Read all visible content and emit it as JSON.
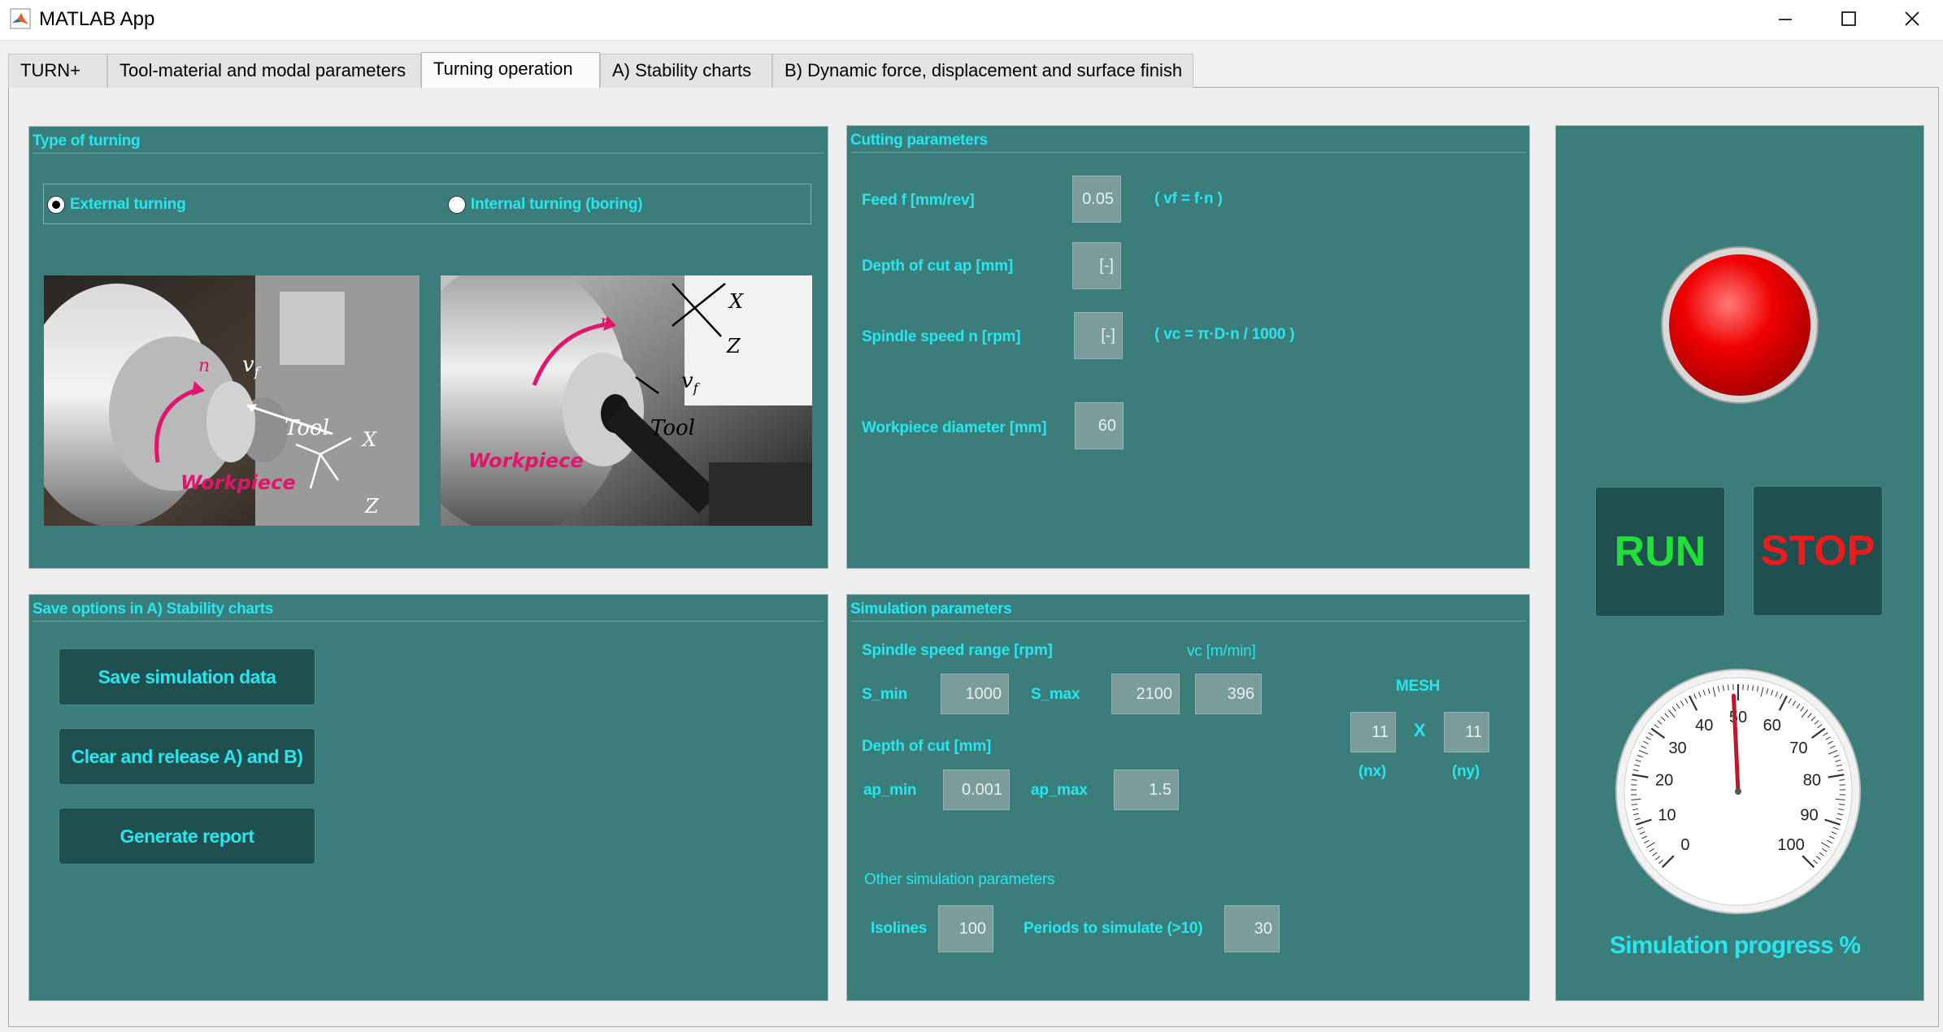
{
  "window": {
    "title": "MATLAB App"
  },
  "tabs": [
    "TURN+",
    "Tool-material and modal parameters",
    "Turning operation",
    "A) Stability charts",
    "B) Dynamic force, displacement and surface finish"
  ],
  "type_of_turning": {
    "title": "Type of turning",
    "option_external": "External turning",
    "option_internal": "Internal turning (boring)",
    "selected": "External turning",
    "image1": {
      "n": "n",
      "vf": "v",
      "vf_sub": "f",
      "tool": "Tool",
      "x": "X",
      "z": "Z",
      "workpiece": "Workpiece"
    },
    "image2": {
      "n": "n",
      "vf": "v",
      "vf_sub": "f",
      "tool": "Tool",
      "x": "X",
      "z": "Z",
      "workpiece": "Workpiece"
    }
  },
  "cutting": {
    "title": "Cutting parameters",
    "feed_label": "Feed f [mm/rev]",
    "feed_value": "0.05",
    "feed_formula": "( vf = f·n )",
    "depth_label": "Depth of cut ap  [mm]",
    "depth_value": "[-]",
    "spindle_label": "Spindle speed n [rpm]",
    "spindle_value": "[-]",
    "spindle_formula": "( vc = π·D·n / 1000 )",
    "diameter_label": "Workpiece diameter [mm]",
    "diameter_value": "60"
  },
  "save_options": {
    "title": "Save options in A) Stability charts",
    "save_button": "Save simulation data",
    "clear_button": "Clear and release A) and B)",
    "report_button": "Generate report"
  },
  "simulation": {
    "title": "Simulation parameters",
    "spindle_range_label": "Spindle speed range [rpm]",
    "vc_label": "vc [m/min]",
    "smin_label": "S_min",
    "smin_value": "1000",
    "smax_label": "S_max",
    "smax_value": "2100",
    "vc_value": "396",
    "depth_label": "Depth of cut [mm]",
    "apmin_label": "ap_min",
    "apmin_value": "0.001",
    "apmax_label": "ap_max",
    "apmax_value": "1.5",
    "mesh_label": "MESH",
    "nx_value": "11",
    "x_label": "X",
    "ny_value": "11",
    "nx_label": "(nx)",
    "ny_label": "(ny)",
    "other_label": "Other simulation parameters",
    "isolines_label": "Isolines",
    "isolines_value": "100",
    "periods_label": "Periods to simulate (>10)",
    "periods_value": "30"
  },
  "control": {
    "run_label": "RUN",
    "stop_label": "STOP",
    "run_color": "#22e03a",
    "stop_color": "#ee1b1b",
    "gauge_ticks": [
      "0",
      "10",
      "20",
      "30",
      "40",
      "50",
      "60",
      "70",
      "80",
      "90",
      "100"
    ],
    "gauge_value": 49,
    "progress_label": "Simulation progress %"
  },
  "colors": {
    "panel_bg": "#3b7d7b",
    "label_cyan": "#27e6ee",
    "lamp_red": "#e00000"
  }
}
